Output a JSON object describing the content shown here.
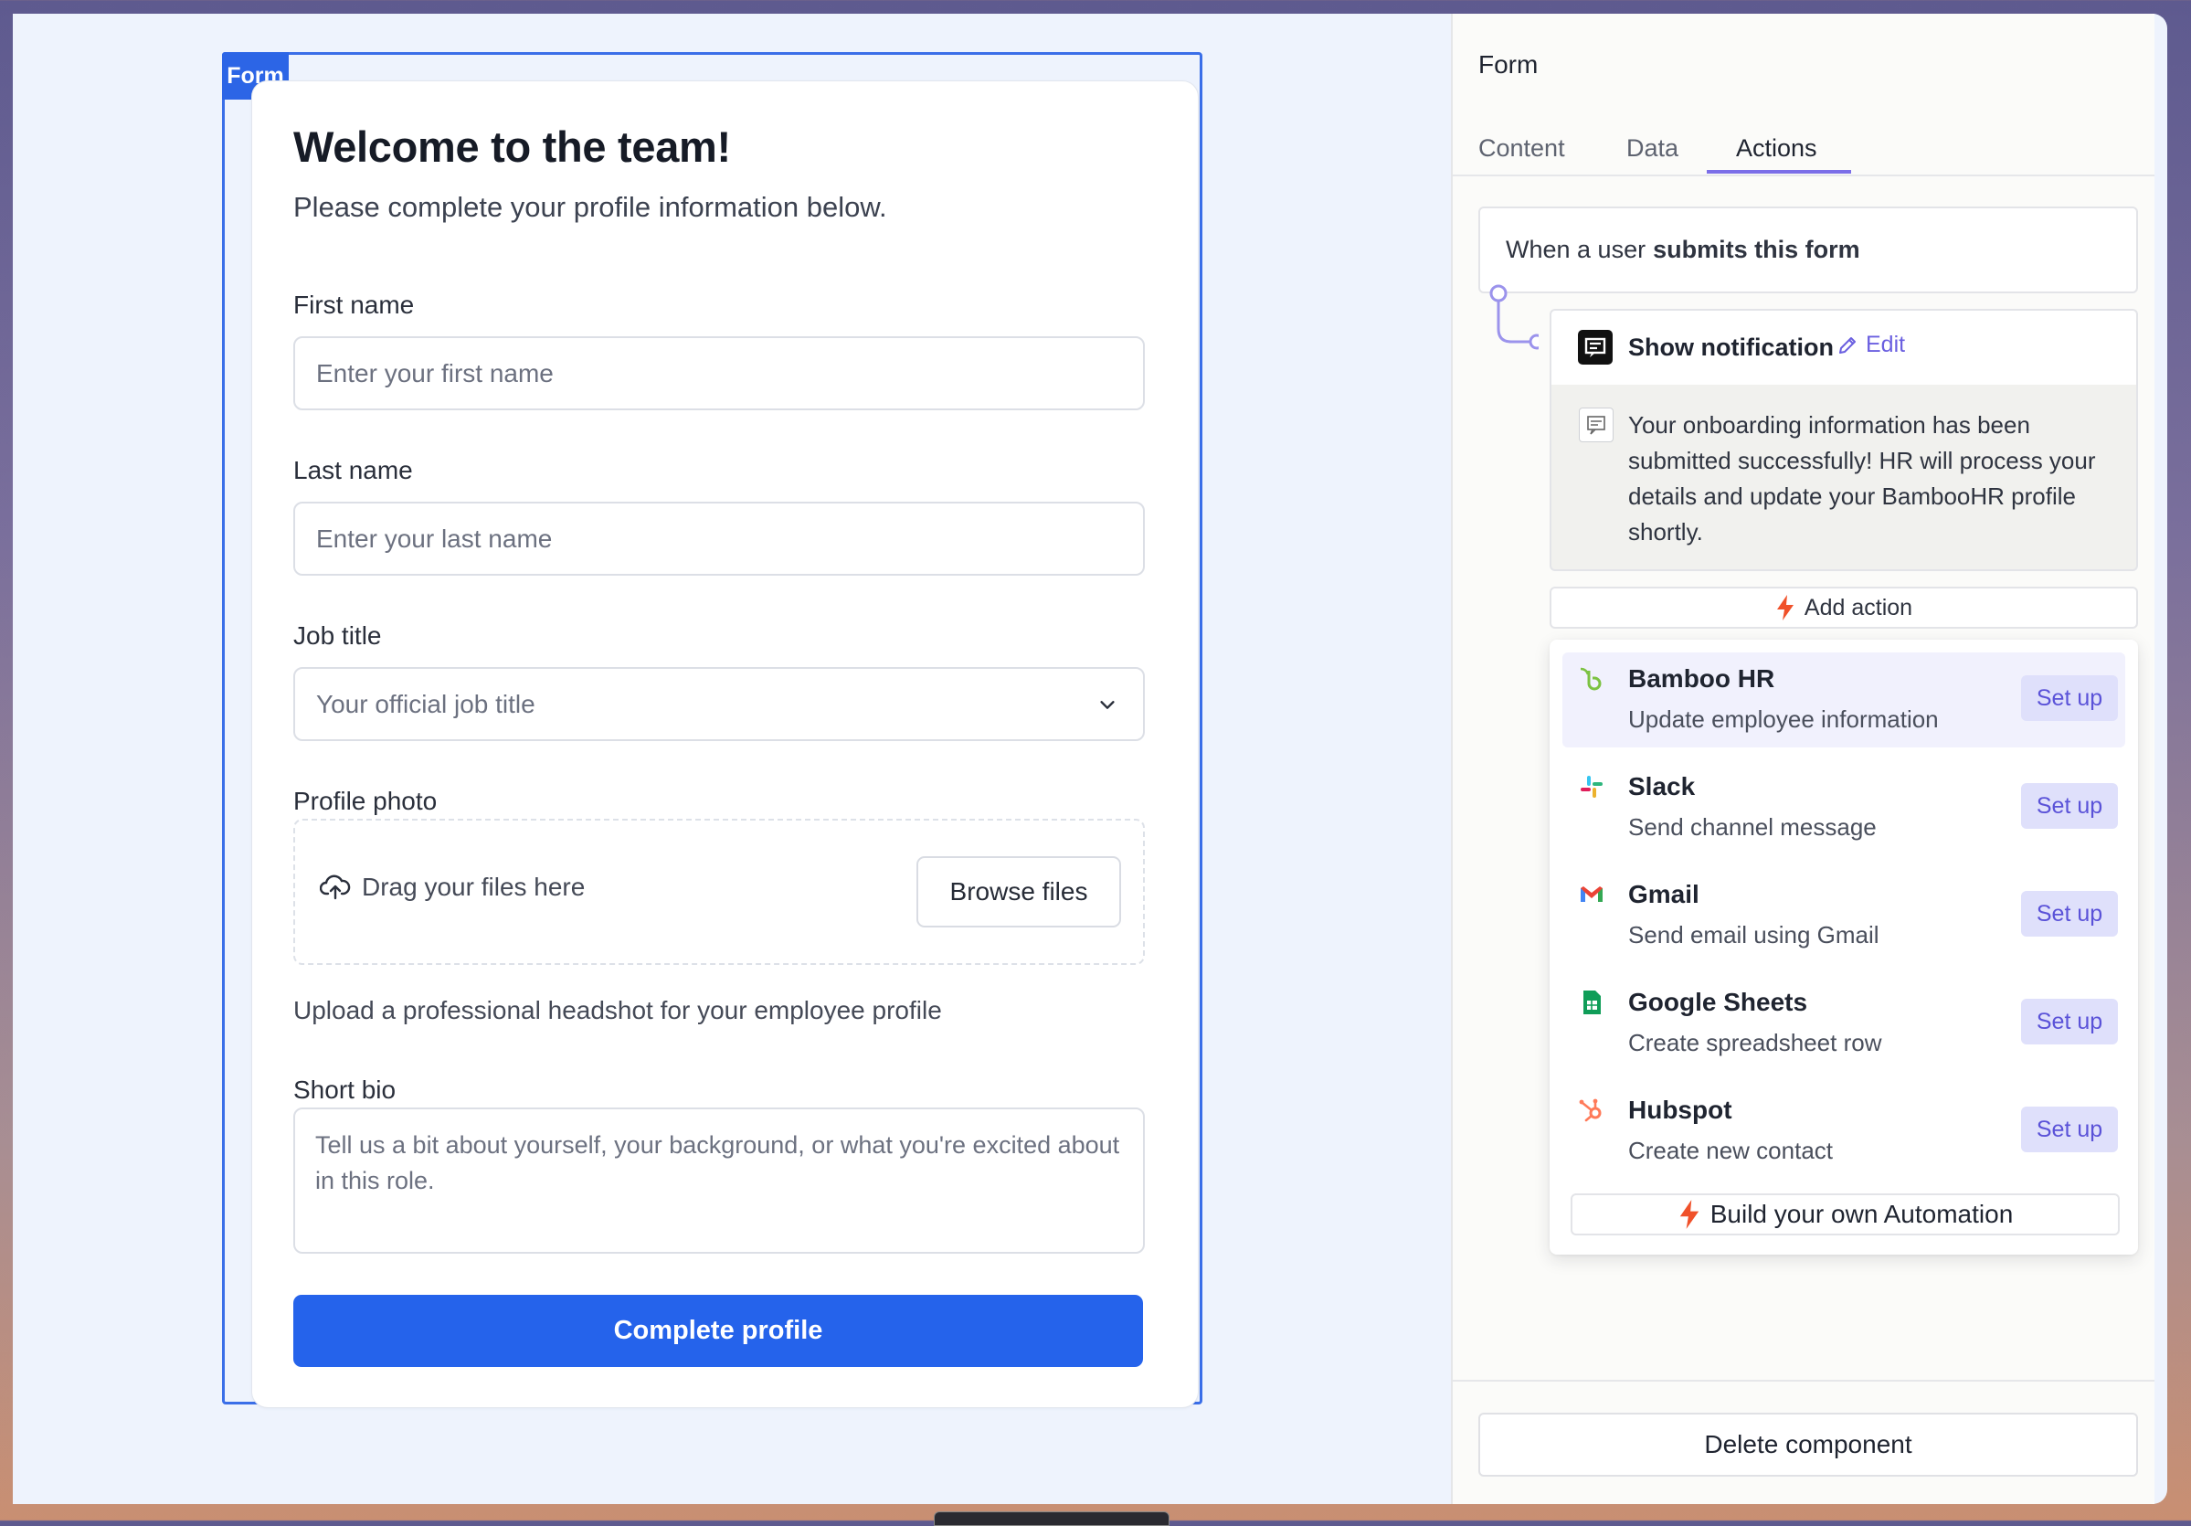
{
  "form_tag": "Form",
  "form": {
    "title": "Welcome to the team!",
    "subtitle": "Please complete your profile information below.",
    "first_name": {
      "label": "First name",
      "placeholder": "Enter your first name"
    },
    "last_name": {
      "label": "Last name",
      "placeholder": "Enter your last name"
    },
    "job_title": {
      "label": "Job title",
      "placeholder": "Your official job title"
    },
    "photo": {
      "label": "Profile photo",
      "drop_text": "Drag your files here",
      "browse": "Browse files",
      "hint": "Upload a professional headshot for your employee profile"
    },
    "bio": {
      "label": "Short bio",
      "placeholder": "Tell us a bit about yourself, your background, or what you're excited about in this role."
    },
    "submit": "Complete profile"
  },
  "panel": {
    "title": "Form",
    "tabs": [
      "Content",
      "Data",
      "Actions"
    ],
    "active_tab": "Actions",
    "trigger_prefix": "When a user",
    "trigger_bold": "submits this form",
    "action": {
      "title": "Show notification",
      "edit": "Edit",
      "message": "Your onboarding information has been submitted successfully! HR will process your details and update your BambooHR profile shortly."
    },
    "add_action": "Add action",
    "options": [
      {
        "name": "Bamboo HR",
        "desc": "Update employee information",
        "setup": "Set up",
        "icon": "bamboohr-icon"
      },
      {
        "name": "Slack",
        "desc": "Send channel message",
        "setup": "Set up",
        "icon": "slack-icon"
      },
      {
        "name": "Gmail",
        "desc": "Send email using Gmail",
        "setup": "Set up",
        "icon": "gmail-icon"
      },
      {
        "name": "Google Sheets",
        "desc": "Create spreadsheet row",
        "setup": "Set up",
        "icon": "google-sheets-icon"
      },
      {
        "name": "Hubspot",
        "desc": "Create new contact",
        "setup": "Set up",
        "icon": "hubspot-icon"
      }
    ],
    "build_automation": "Build your own Automation",
    "delete": "Delete component"
  },
  "colors": {
    "primary": "#2563eb",
    "accent": "#7b6ee8",
    "bolt": "#f0512a"
  }
}
